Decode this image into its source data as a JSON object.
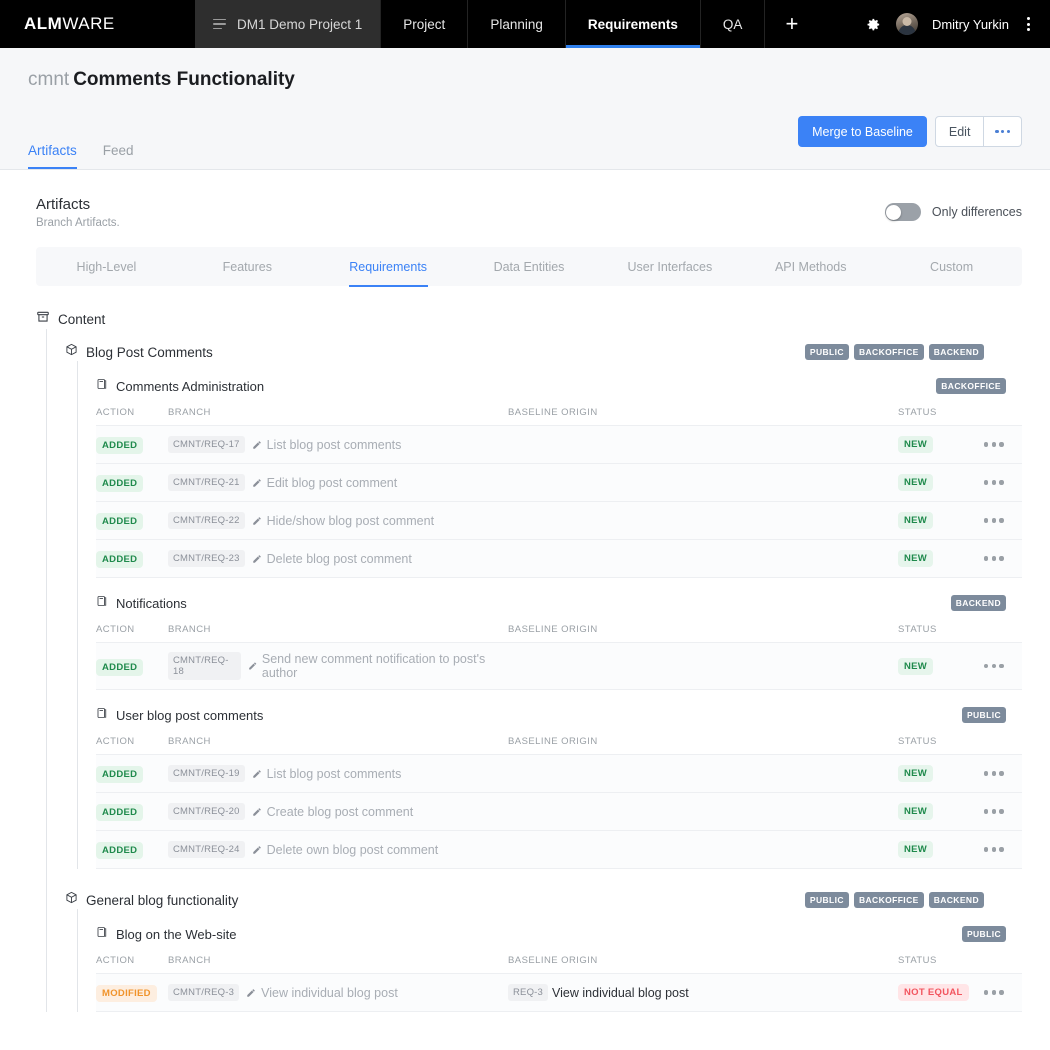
{
  "topnav": {
    "brand_bold": "ALM",
    "brand_light": "WARE",
    "project_selector": "DM1 Demo Project 1",
    "items": [
      {
        "label": "Project",
        "active": false
      },
      {
        "label": "Planning",
        "active": false
      },
      {
        "label": "Requirements",
        "active": true
      },
      {
        "label": "QA",
        "active": false
      }
    ],
    "add_label": "+",
    "user_name": "Dmitry Yurkin"
  },
  "page_header": {
    "key": "cmnt",
    "title": "Comments Functionality",
    "merge_label": "Merge to Baseline",
    "edit_label": "Edit",
    "tabs": [
      {
        "label": "Artifacts",
        "active": true
      },
      {
        "label": "Feed",
        "active": false
      }
    ]
  },
  "artifacts": {
    "heading": "Artifacts",
    "subheading": "Branch Artifacts.",
    "toggle_label": "Only differences",
    "toggle_on": false,
    "segments": [
      {
        "label": "High-Level",
        "active": false
      },
      {
        "label": "Features",
        "active": false
      },
      {
        "label": "Requirements",
        "active": true
      },
      {
        "label": "Data Entities",
        "active": false
      },
      {
        "label": "User Interfaces",
        "active": false
      },
      {
        "label": "API Methods",
        "active": false
      },
      {
        "label": "Custom",
        "active": false
      }
    ]
  },
  "columns": {
    "action": "ACTION",
    "branch": "BRANCH",
    "origin": "BASELINE ORIGIN",
    "status": "STATUS"
  },
  "content": {
    "label": "Content",
    "packages": [
      {
        "label": "Blog Post Comments",
        "tags": [
          "PUBLIC",
          "BACKOFFICE",
          "BACKEND"
        ],
        "modules": [
          {
            "label": "Comments Administration",
            "tags": [
              "BACKOFFICE"
            ],
            "rows": [
              {
                "action": "ADDED",
                "branch_id": "CMNT/REQ-17",
                "branch_text": "List blog post comments",
                "origin_id": "",
                "origin_text": "",
                "status": "NEW"
              },
              {
                "action": "ADDED",
                "branch_id": "CMNT/REQ-21",
                "branch_text": "Edit blog post comment",
                "origin_id": "",
                "origin_text": "",
                "status": "NEW"
              },
              {
                "action": "ADDED",
                "branch_id": "CMNT/REQ-22",
                "branch_text": "Hide/show blog post comment",
                "origin_id": "",
                "origin_text": "",
                "status": "NEW"
              },
              {
                "action": "ADDED",
                "branch_id": "CMNT/REQ-23",
                "branch_text": "Delete blog post comment",
                "origin_id": "",
                "origin_text": "",
                "status": "NEW"
              }
            ]
          },
          {
            "label": "Notifications",
            "tags": [
              "BACKEND"
            ],
            "rows": [
              {
                "action": "ADDED",
                "branch_id": "CMNT/REQ-18",
                "branch_text": "Send new comment notification to post's author",
                "origin_id": "",
                "origin_text": "",
                "status": "NEW"
              }
            ]
          },
          {
            "label": "User blog post comments",
            "tags": [
              "PUBLIC"
            ],
            "rows": [
              {
                "action": "ADDED",
                "branch_id": "CMNT/REQ-19",
                "branch_text": "List blog post comments",
                "origin_id": "",
                "origin_text": "",
                "status": "NEW"
              },
              {
                "action": "ADDED",
                "branch_id": "CMNT/REQ-20",
                "branch_text": "Create blog post comment",
                "origin_id": "",
                "origin_text": "",
                "status": "NEW"
              },
              {
                "action": "ADDED",
                "branch_id": "CMNT/REQ-24",
                "branch_text": "Delete own blog post comment",
                "origin_id": "",
                "origin_text": "",
                "status": "NEW"
              }
            ]
          }
        ]
      },
      {
        "label": "General blog functionality",
        "tags": [
          "PUBLIC",
          "BACKOFFICE",
          "BACKEND"
        ],
        "modules": [
          {
            "label": "Blog on the Web-site",
            "tags": [
              "PUBLIC"
            ],
            "rows": [
              {
                "action": "MODIFIED",
                "branch_id": "CMNT/REQ-3",
                "branch_text": "View individual blog post",
                "origin_id": "REQ-3",
                "origin_text": "View individual blog post",
                "status": "NOT EQUAL"
              }
            ]
          }
        ]
      }
    ]
  },
  "colors": {
    "accent": "#3b82f6",
    "added": "#1f8a4c",
    "modified": "#f0932b",
    "not_equal": "#f2555f",
    "tag": "#7d8b9c"
  }
}
